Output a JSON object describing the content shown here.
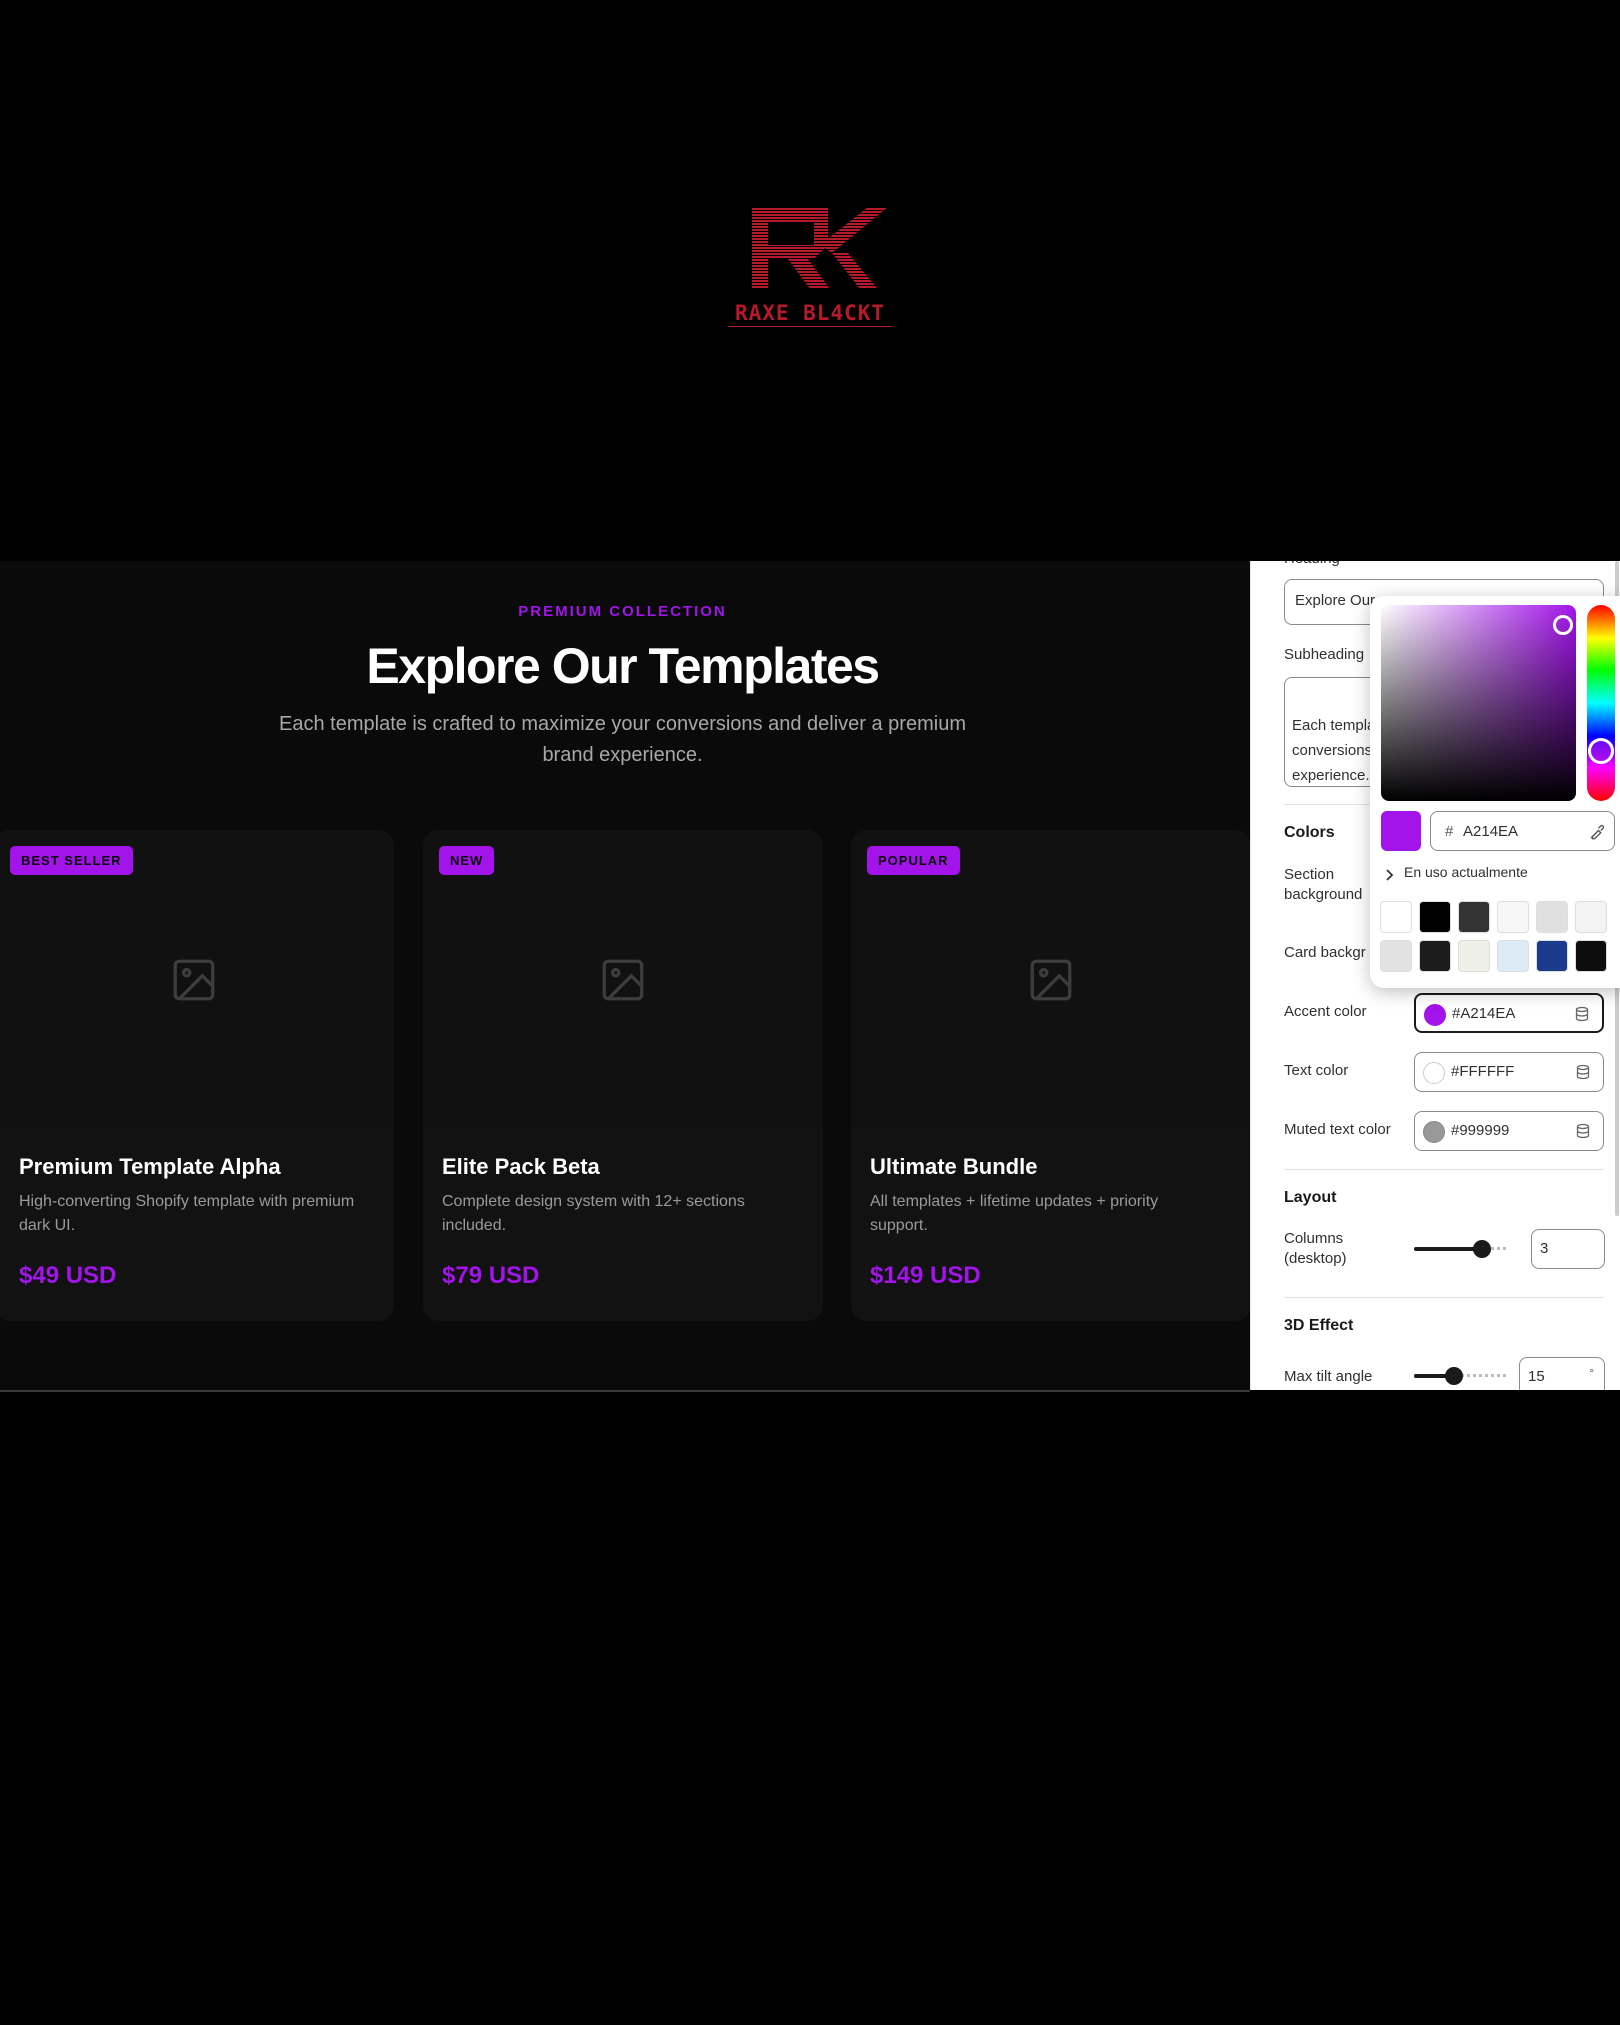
{
  "logo": {
    "text": "RAXE BL4CKT",
    "color": "#b51a2a"
  },
  "section": {
    "eyebrow": "PREMIUM COLLECTION",
    "heading": "Explore Our Templates",
    "subheading": "Each template is crafted to maximize your conversions and deliver a premium brand experience."
  },
  "cards": [
    {
      "badge": "BEST SELLER",
      "title": "Premium Template Alpha",
      "desc": "High-converting Shopify template with premium dark UI.",
      "price": "$49 USD"
    },
    {
      "badge": "NEW",
      "title": "Elite Pack Beta",
      "desc": "Complete design system with 12+ sections included.",
      "price": "$79 USD"
    },
    {
      "badge": "POPULAR",
      "title": "Ultimate Bundle",
      "desc": "All templates + lifetime updates + priority support.",
      "price": "$149 USD"
    }
  ],
  "panel": {
    "heading_label": "Heading",
    "heading_value": "Explore Our",
    "subheading_label": "Subheading",
    "subheading_value": "Each templa\nconversions\nexperience.",
    "colors_title": "Colors",
    "section_bg_label": "Section background",
    "card_bg_label": "Card backgr",
    "accent": {
      "label": "Accent color",
      "value": "#A214EA",
      "color": "#a214ea"
    },
    "text": {
      "label": "Text color",
      "value": "#FFFFFF",
      "color": "#ffffff"
    },
    "muted": {
      "label": "Muted text color",
      "value": "#999999",
      "color": "#999999"
    },
    "layout_title": "Layout",
    "columns_label": "Columns (desktop)",
    "columns_value": "3",
    "effect_title": "3D Effect",
    "tilt_label": "Max tilt angle",
    "tilt_value": "15",
    "tilt_unit": "°"
  },
  "picker": {
    "hash": "#",
    "hex": "A214EA",
    "in_use_label": "En uso actualmente",
    "swatches_row1": [
      "#ffffff",
      "#000000",
      "#333333",
      "#f7f7f7",
      "#e0e0e0",
      "#f3f3f3"
    ],
    "swatches_row2": [
      "#e2e2e2",
      "#1c1c1c",
      "#eef0e8",
      "#dceaf5",
      "#1b3a8c",
      "#0d0d0d"
    ]
  }
}
